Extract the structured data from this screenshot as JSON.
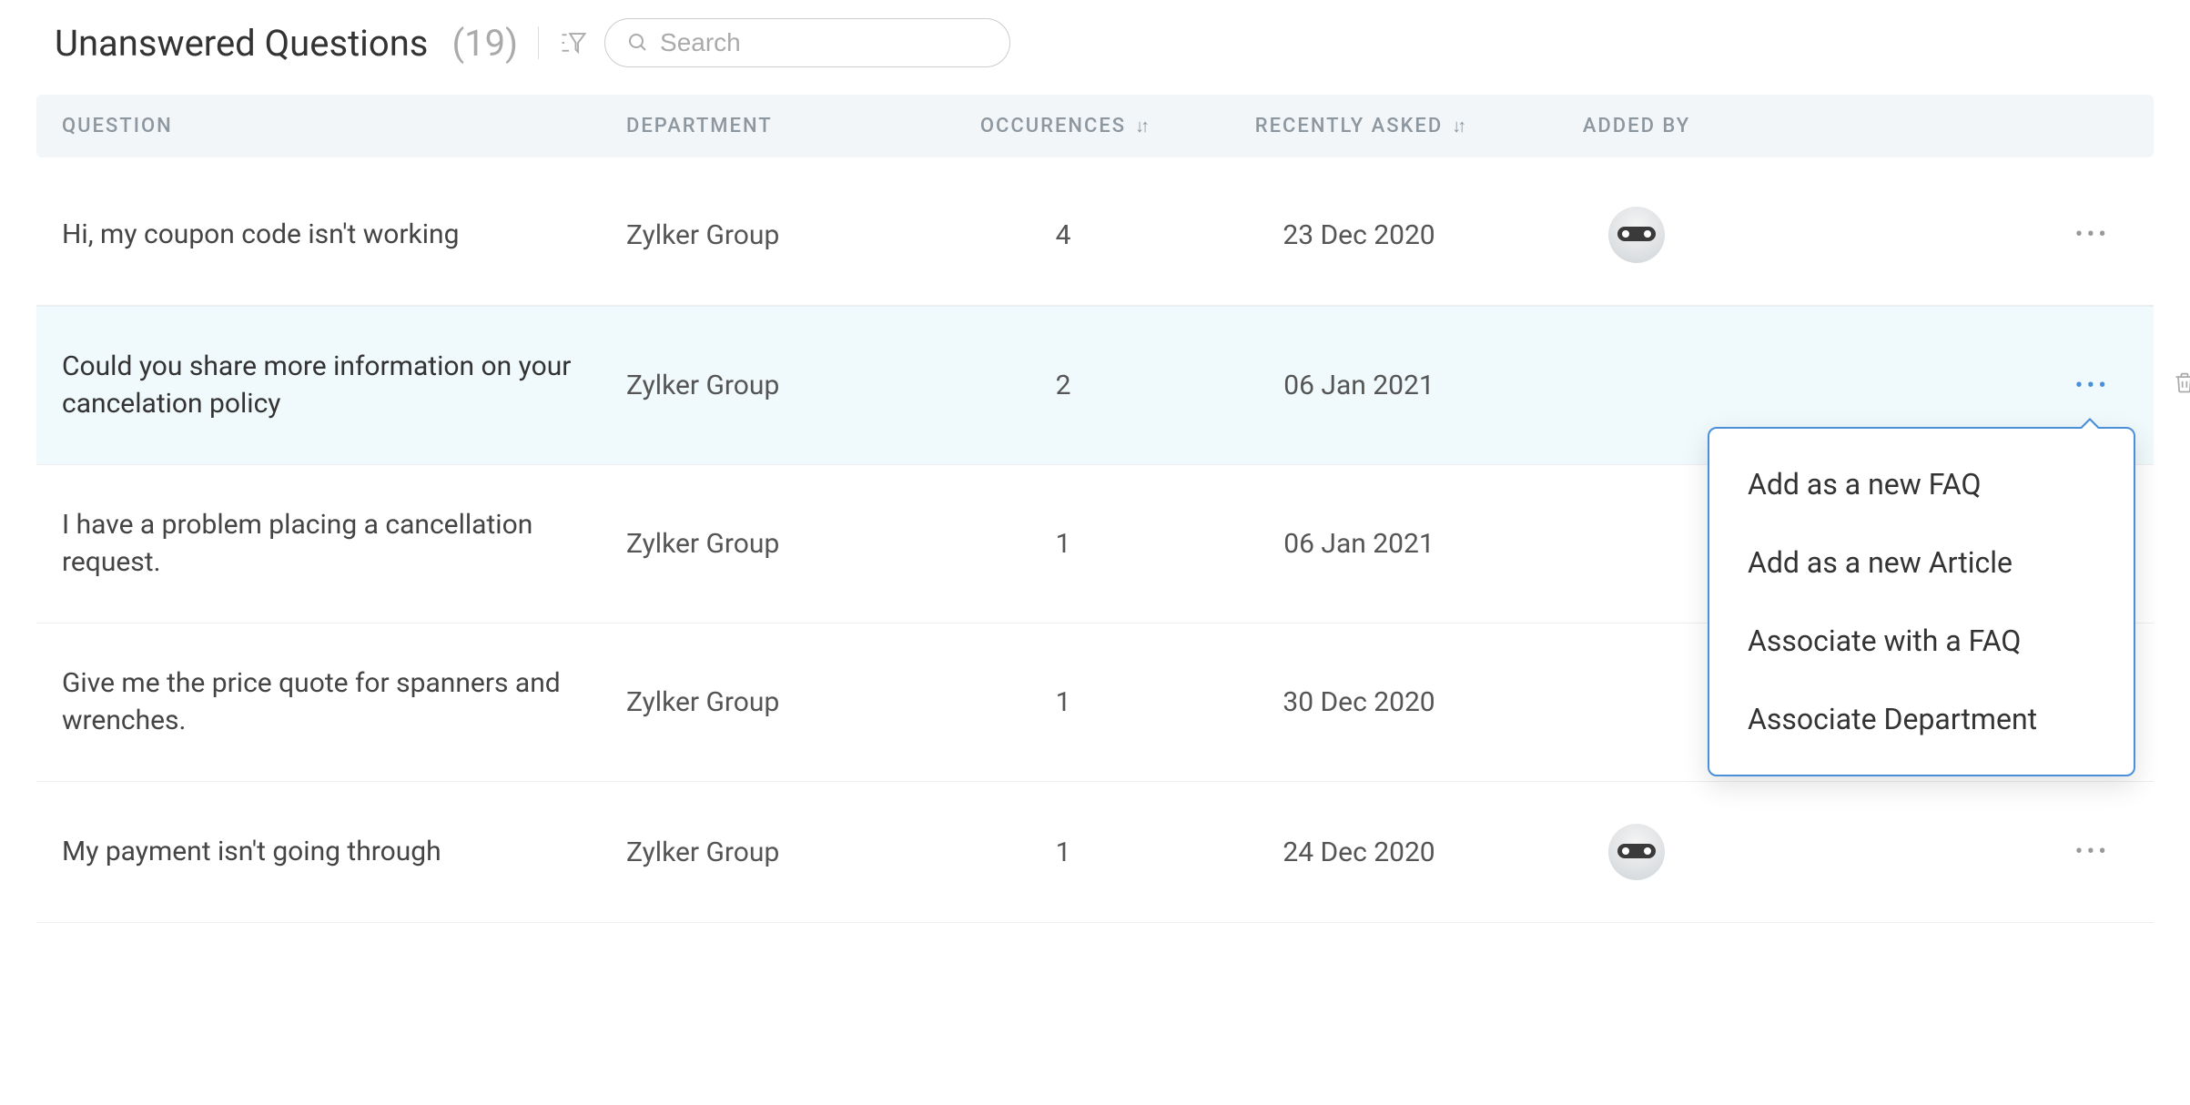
{
  "header": {
    "title": "Unanswered Questions",
    "count": "(19)"
  },
  "search": {
    "placeholder": "Search"
  },
  "columns": {
    "question": "QUESTION",
    "department": "DEPARTMENT",
    "occurences": "OCCURENCES",
    "recently_asked": "RECENTLY ASKED",
    "added_by": "ADDED BY"
  },
  "rows": [
    {
      "question": "Hi, my coupon code isn't working",
      "department": "Zylker Group",
      "occurences": "4",
      "recently_asked": "23 Dec 2020",
      "show_avatar": true,
      "highlight": false,
      "menu_open": false
    },
    {
      "question": "Could you share more information on your cancelation policy",
      "department": "Zylker Group",
      "occurences": "2",
      "recently_asked": "06 Jan 2021",
      "show_avatar": false,
      "highlight": true,
      "menu_open": true,
      "show_trash": true
    },
    {
      "question": "I have a problem placing a cancellation request.",
      "department": "Zylker Group",
      "occurences": "1",
      "recently_asked": "06 Jan 2021",
      "show_avatar": false,
      "highlight": false,
      "menu_open": false
    },
    {
      "question": "Give me the price quote for spanners and wrenches.",
      "department": "Zylker Group",
      "occurences": "1",
      "recently_asked": "30 Dec 2020",
      "show_avatar": false,
      "highlight": false,
      "menu_open": false
    },
    {
      "question": "My payment isn't going through",
      "department": "Zylker Group",
      "occurences": "1",
      "recently_asked": "24 Dec 2020",
      "show_avatar": true,
      "highlight": false,
      "menu_open": false
    }
  ],
  "popover": {
    "items": [
      "Add as a new FAQ",
      "Add as a new Article",
      "Associate with a FAQ",
      "Associate Department"
    ]
  }
}
